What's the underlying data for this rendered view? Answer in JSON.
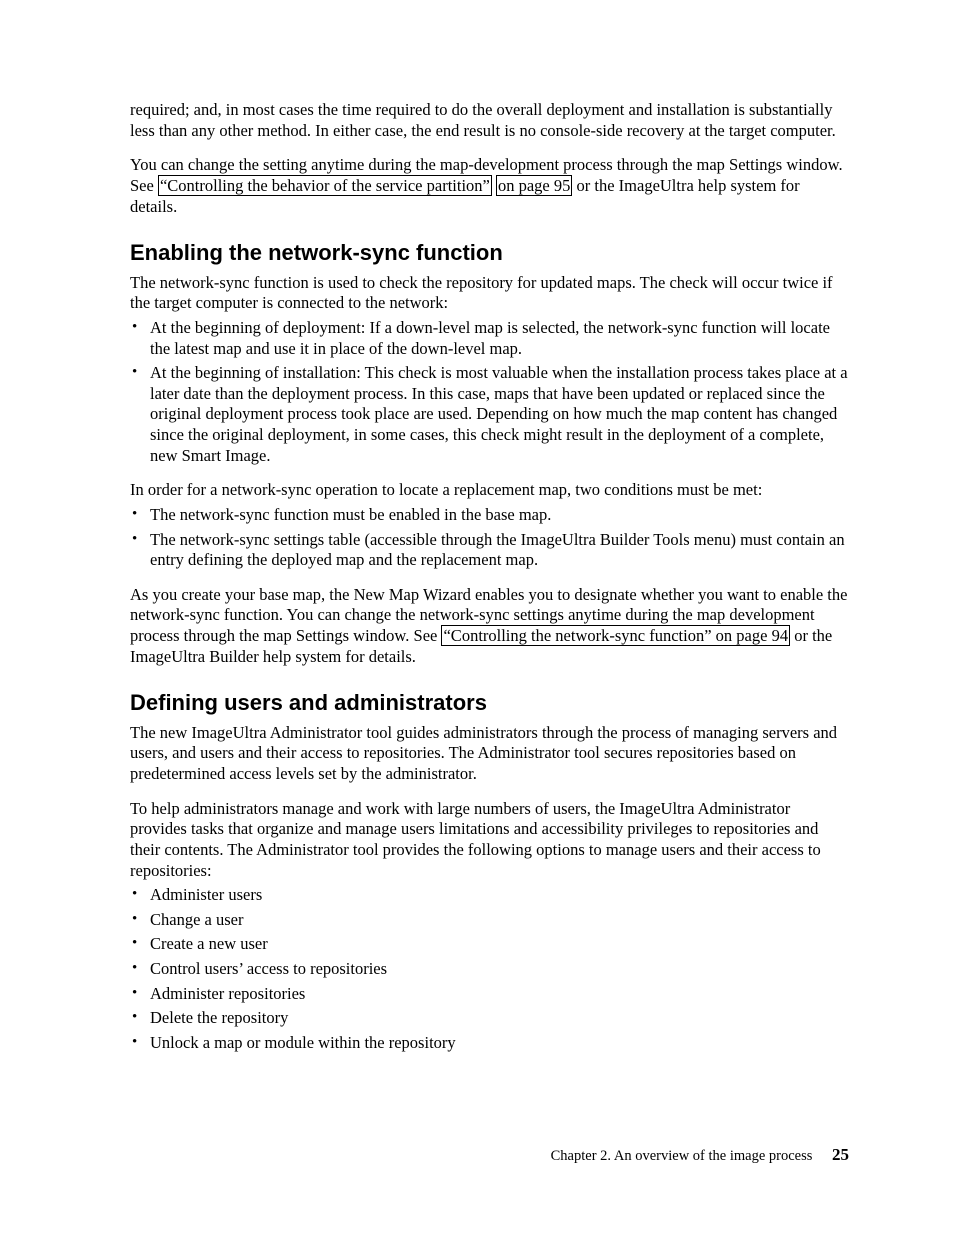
{
  "top_para": "required; and, in most cases the time required to do the overall deployment and installation is substantially less than any other method. In either case, the end result is no console-side recovery at the target computer.",
  "change_para_pre": "You can change the setting anytime during the map-development process through the map Settings window. See ",
  "change_link1": "“Controlling the behavior of the service partition”",
  "change_link2": "on page 95",
  "change_para_post": " or the ImageUltra help system for details.",
  "h_enable": "Enabling the network-sync function",
  "enable_intro": "The network-sync function is used to check the repository for updated maps. The check will occur twice if the target computer is connected to the network:",
  "enable_b1": "At the beginning of deployment: If a down-level map is selected, the network-sync function will locate the latest map and use it in place of the down-level map.",
  "enable_b2": "At the beginning of installation: This check is most valuable when the installation process takes place at a later date than the deployment process. In this case, maps that have been updated or replaced since the original deployment process took place are used. Depending on how much the map content has changed since the original deployment, in some cases, this check might result in the deployment of a complete, new Smart Image.",
  "enable_cond_intro": "In order for a network-sync operation to locate a replacement map, two conditions must be met:",
  "enable_c1": "The network-sync function must be enabled in the base map.",
  "enable_c2": "The network-sync settings table (accessible through the ImageUltra Builder Tools menu) must contain an entry defining the deployed map and the replacement map.",
  "enable_close_pre": "As you create your base map, the New Map Wizard enables you to designate whether you want to enable the network-sync function. You can change the network-sync settings anytime during the map development process through the map Settings window. See ",
  "enable_close_link": "“Controlling the network-sync function” on page 94",
  "enable_close_post": " or the ImageUltra Builder help system for details.",
  "h_define": "Defining users and administrators",
  "define_p1": "The new ImageUltra Administrator tool guides administrators through the process of managing servers and users, and users and their access to repositories. The Administrator tool secures repositories based on predetermined access levels set by the administrator.",
  "define_p2": "To help administrators manage and work with large numbers of users, the ImageUltra Administrator provides tasks that organize and manage users limitations and accessibility privileges to repositories and their contents. The Administrator tool provides the following options to manage users and their access to repositories:",
  "define_items": [
    "Administer users",
    "Change a user",
    "Create a new user",
    "Control users’ access to repositories",
    "Administer repositories",
    "Delete the repository",
    "Unlock a map or module within the repository"
  ],
  "footer_chapter": "Chapter 2. An overview of the image process",
  "footer_page": "25"
}
